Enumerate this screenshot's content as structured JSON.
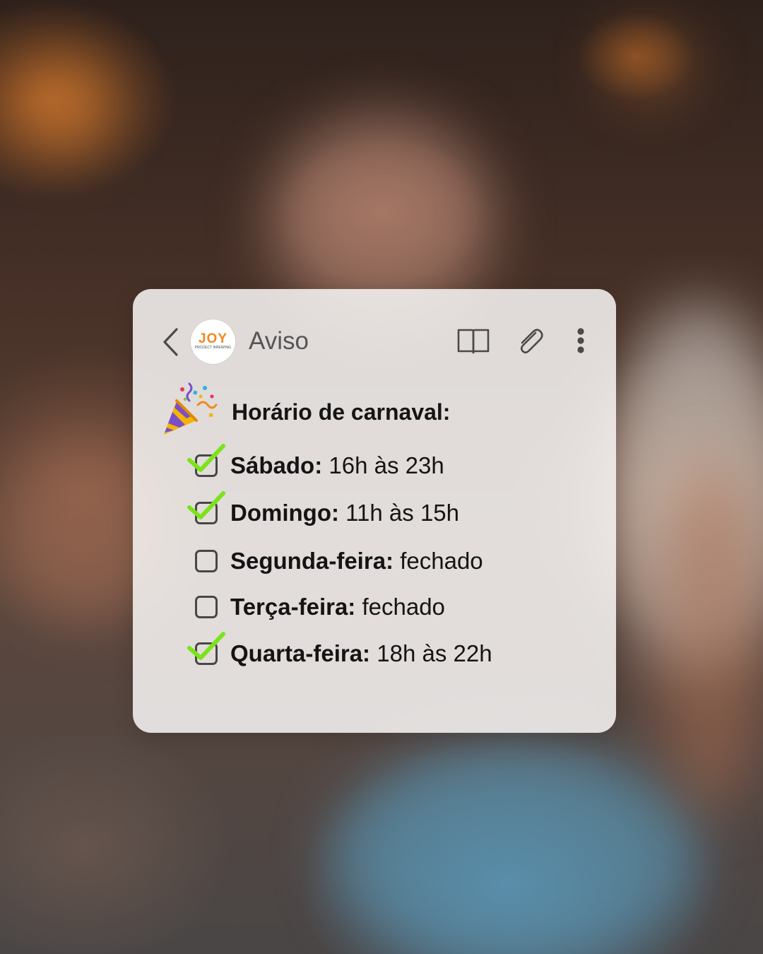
{
  "header": {
    "title": "Aviso",
    "avatar_logo": "JOY",
    "avatar_sub": "PROJECT BREWING"
  },
  "content": {
    "heading": "Horário de carnaval:",
    "items": [
      {
        "day": "Sábado:",
        "hours": "16h às 23h",
        "checked": true
      },
      {
        "day": "Domingo:",
        "hours": "11h às 15h",
        "checked": true
      },
      {
        "day": "Segunda-feira:",
        "hours": "fechado",
        "checked": false
      },
      {
        "day": "Terça-feira:",
        "hours": "fechado",
        "checked": false
      },
      {
        "day": "Quarta-feira:",
        "hours": "18h às 22h",
        "checked": true
      }
    ]
  },
  "icons": {
    "back": "chevron-left-icon",
    "reader": "book-icon",
    "attach": "paperclip-icon",
    "more": "more-vertical-icon",
    "party": "party-popper-icon",
    "check": "check-mark-icon"
  },
  "colors": {
    "check_green": "#7ce31a",
    "logo_orange": "#f0881e",
    "card_bg": "#f5f3f1"
  }
}
